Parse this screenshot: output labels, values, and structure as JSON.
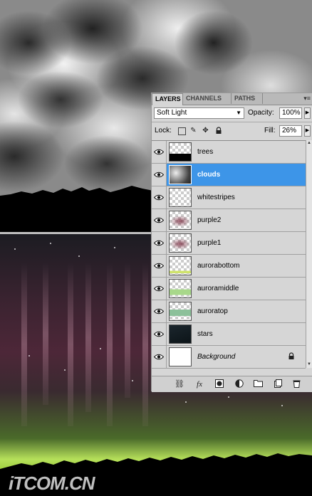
{
  "canvas": {
    "watermark": "iTCOM.CN"
  },
  "panel": {
    "tabs": [
      {
        "label": "LAYERS",
        "active": true
      },
      {
        "label": "CHANNELS",
        "active": false
      },
      {
        "label": "PATHS",
        "active": false
      }
    ],
    "menu_icon": "panel-menu-icon",
    "blend_mode": "Soft Light",
    "opacity_label": "Opacity:",
    "opacity_value": "100%",
    "lock_label": "Lock:",
    "fill_label": "Fill:",
    "fill_value": "26%",
    "layers": [
      {
        "name": "trees",
        "selected": false,
        "thumb": "trees"
      },
      {
        "name": "clouds",
        "selected": true,
        "thumb": "clouds"
      },
      {
        "name": "whitestripes",
        "selected": false,
        "thumb": "empty"
      },
      {
        "name": "purple2",
        "selected": false,
        "thumb": "purple"
      },
      {
        "name": "purple1",
        "selected": false,
        "thumb": "purple"
      },
      {
        "name": "aurorabottom",
        "selected": false,
        "thumb": "green-bottom"
      },
      {
        "name": "auroramiddle",
        "selected": false,
        "thumb": "green-mid"
      },
      {
        "name": "auroratop",
        "selected": false,
        "thumb": "green-top"
      },
      {
        "name": "stars",
        "selected": false,
        "thumb": "stars"
      },
      {
        "name": "Background",
        "selected": false,
        "thumb": "white",
        "italic": true,
        "locked": true
      }
    ],
    "footer_icons": [
      "link-layers-icon",
      "fx-icon",
      "layer-mask-icon",
      "adjustment-layer-icon",
      "new-group-icon",
      "new-layer-icon",
      "delete-layer-icon"
    ]
  }
}
